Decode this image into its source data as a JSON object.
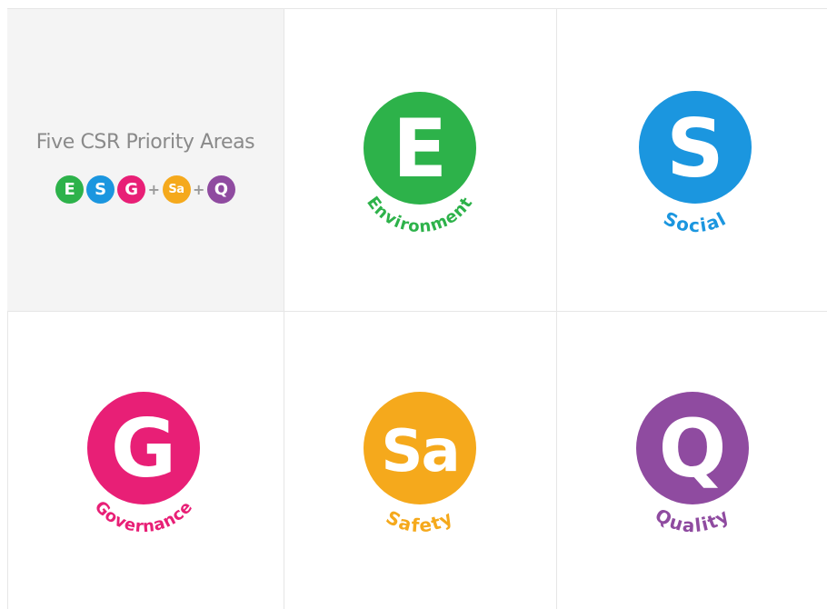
{
  "intro": {
    "title": "Five CSR Priority Areas",
    "badges": [
      {
        "letter": "E",
        "color": "#2db24a"
      },
      {
        "letter": "S",
        "color": "#1b96df"
      },
      {
        "letter": "G",
        "color": "#e81f76"
      },
      {
        "letter": "Sa",
        "color": "#f5a91c"
      },
      {
        "letter": "Q",
        "color": "#8f4ba0"
      }
    ],
    "plus": "+"
  },
  "areas": [
    {
      "key": "environment",
      "letter": "E",
      "label": "Environment",
      "color": "#2db24a",
      "letter_color": "#ffffff"
    },
    {
      "key": "social",
      "letter": "S",
      "label": "Social",
      "color": "#1b96df",
      "letter_color": "#ffffff"
    },
    {
      "key": "governance",
      "letter": "G",
      "label": "Governance",
      "color": "#e81f76",
      "letter_color": "#ffffff"
    },
    {
      "key": "safety",
      "letter": "Sa",
      "label": "Safety",
      "color": "#f5a91c",
      "letter_color": "#ffffff"
    },
    {
      "key": "quality",
      "letter": "Q",
      "label": "Quality",
      "color": "#8f4ba0",
      "letter_color": "#ffffff"
    }
  ]
}
